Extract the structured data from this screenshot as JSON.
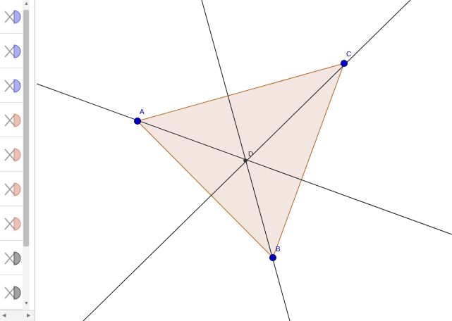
{
  "algebra_view": {
    "rows": [
      {
        "name": "row-1",
        "color": "#6b6bde"
      },
      {
        "name": "row-2",
        "color": "#6b6bde"
      },
      {
        "name": "row-3",
        "color": "#6b6bde"
      },
      {
        "name": "row-4",
        "color": "#d98e7a"
      },
      {
        "name": "row-5",
        "color": "#d98e7a"
      },
      {
        "name": "row-6",
        "color": "#d98e7a"
      },
      {
        "name": "row-7",
        "color": "#d98e7a"
      },
      {
        "name": "row-8",
        "color": "#555555"
      },
      {
        "name": "row-9",
        "color": "#555555"
      }
    ],
    "scroll_up": "▲",
    "scroll_down": "▼",
    "scroll_left": "◀",
    "scroll_right": "▶"
  },
  "graphics": {
    "points": {
      "A": {
        "label": "A"
      },
      "B": {
        "label": "B"
      },
      "C": {
        "label": "C"
      },
      "D": {
        "label": "D"
      }
    },
    "colors": {
      "point": "#0000cc",
      "polygon_fill": "#f3e6e1",
      "polygon_stroke": "#b5651d",
      "line": "#1a1a1a",
      "label_free": "#0000cc",
      "label_intersection": "#333333"
    }
  }
}
